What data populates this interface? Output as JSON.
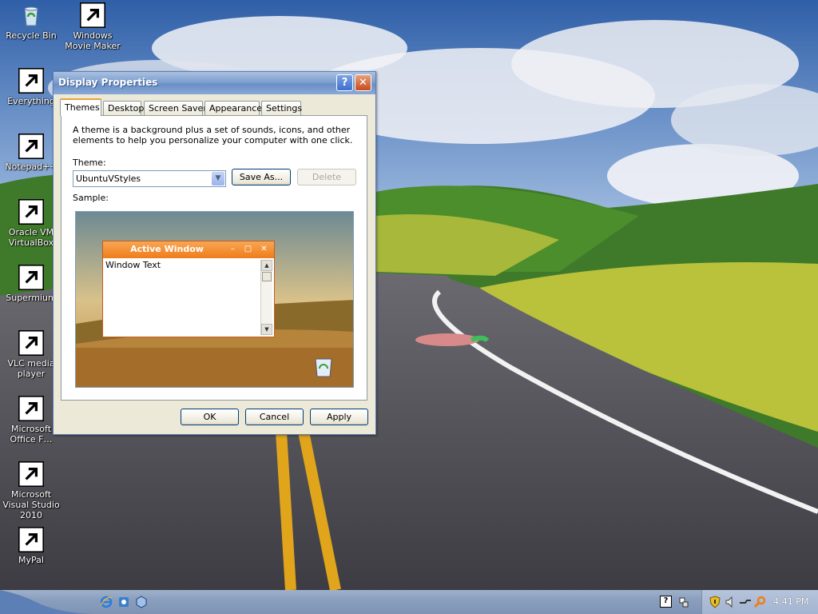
{
  "desktop": {
    "icons": [
      {
        "label": "Recycle Bin",
        "icon": "recycle-bin-icon"
      },
      {
        "label": "Windows Movie Maker",
        "icon": "film-reel-icon"
      },
      {
        "label": "Everything",
        "icon": "search-ring-icon"
      },
      {
        "label": "Notepad++",
        "icon": "notepad-icon"
      },
      {
        "label": "Oracle VM VirtualBox",
        "icon": "virtualbox-cube-icon"
      },
      {
        "label": "Supermium",
        "icon": "browser-globe-icon"
      },
      {
        "label": "VLC media player",
        "icon": "vlc-cone-icon"
      },
      {
        "label": "Microsoft Office F…",
        "icon": "office-doc-icon"
      },
      {
        "label": "Microsoft Visual Studio 2010",
        "icon": "visual-studio-icon"
      },
      {
        "label": "MyPal",
        "icon": "raccoon-icon"
      }
    ]
  },
  "dialog": {
    "title": "Display Properties",
    "help_glyph": "?",
    "close_glyph": "✕",
    "tabs": [
      "Themes",
      "Desktop",
      "Screen Saver",
      "Appearance",
      "Settings"
    ],
    "active_tab": "Themes",
    "description": "A theme is a background plus a set of sounds, icons, and other elements to help you personalize your computer with one click.",
    "theme_label": "Theme:",
    "theme_value": "UbuntuVStyles",
    "save_as_label": "Save As...",
    "delete_label": "Delete",
    "sample_label": "Sample:",
    "sample": {
      "window_title": "Active Window",
      "window_text": "Window Text",
      "min_glyph": "–",
      "max_glyph": "□",
      "close_glyph": "✕"
    },
    "ok_label": "OK",
    "cancel_label": "Cancel",
    "apply_label": "Apply"
  },
  "taskbar": {
    "quick_launch": [
      "internet-explorer-icon",
      "browser-icon",
      "virtualbox-icon"
    ],
    "tray_icons": [
      "help-icon",
      "network-icon",
      "security-shield-icon",
      "speaker-icon",
      "network-cable-icon",
      "search-magnifier-icon"
    ],
    "help_glyph": "?",
    "clock": "4:41 PM"
  },
  "colors": {
    "title_accent": "#ee7d1c",
    "tab_accent": "#e6a23c",
    "dialog_face": "#ece9d8"
  }
}
